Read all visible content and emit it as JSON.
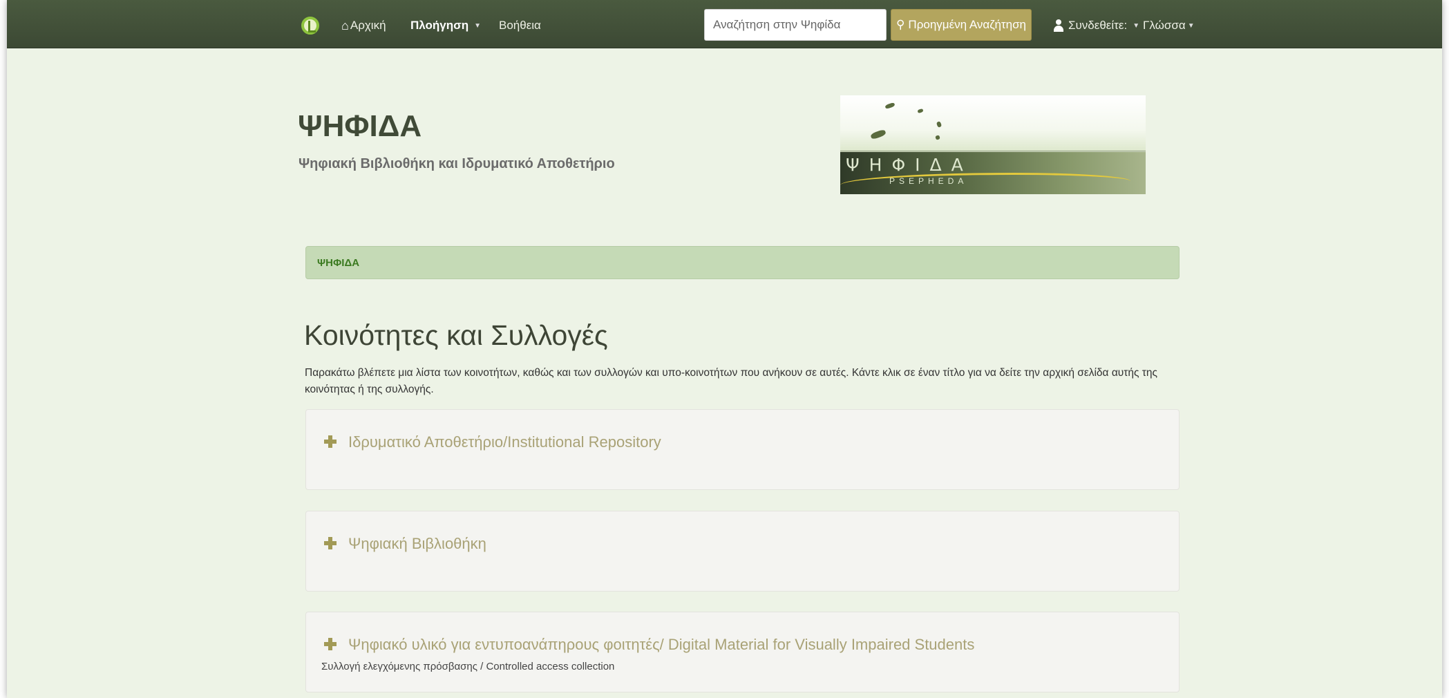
{
  "navbar": {
    "home_label": "Αρχική",
    "browse_label": "Πλοήγηση",
    "help_label": "Βοήθεια",
    "search_placeholder": "Αναζήτηση στην Ψηφίδα",
    "advanced_search_label": "Προηγμένη Αναζήτηση",
    "login_label": "Συνδεθείτε:",
    "language_label": "Γλώσσα"
  },
  "header": {
    "title": "ΨΗΦΙΔΑ",
    "subtitle": "Ψηφιακή Βιβλιοθήκη και Ιδρυματικό Αποθετήριο",
    "banner_title": "ΨΗΦΙΔΑ",
    "banner_subtitle": "PSEPHEDA"
  },
  "breadcrumb": {
    "current": "ΨΗΦΙΔΑ"
  },
  "main": {
    "heading": "Κοινότητες και Συλλογές",
    "intro": "Παρακάτω βλέπετε μια λίστα των κοινοτήτων, καθώς και των συλλογών και υπο-κοινοτήτων που ανήκουν σε αυτές. Κάντε κλικ σε έναν τίτλο για να δείτε την αρχική σελίδα αυτής της κοινότητας ή της συλλογής.",
    "communities": [
      {
        "title": "Ιδρυματικό Αποθετήριο/Institutional Repository",
        "description": ""
      },
      {
        "title": "Ψηφιακή Βιβλιοθήκη",
        "description": ""
      },
      {
        "title": "Ψηφιακό υλικό για εντυποανάπηρους φοιτητές/ Digital Material for Visually Impaired Students",
        "description": "Συλλογή ελεγχόμενης πρόσβασης / Controlled access collection"
      }
    ]
  },
  "colors": {
    "navbar": "#3c4934",
    "accent": "#b3a55e",
    "page_background": "#edf3e6",
    "breadcrumb_background": "#c5dab6"
  },
  "icons": [
    "logo-icon",
    "home-icon",
    "search-icon",
    "user-icon",
    "plus-icon"
  ]
}
